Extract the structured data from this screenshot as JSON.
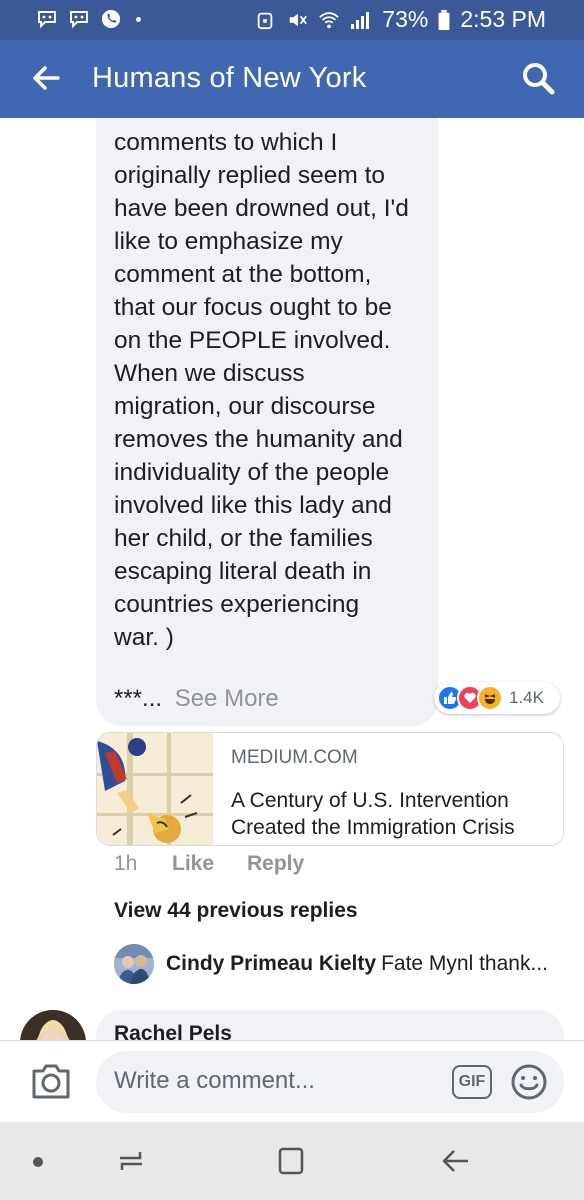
{
  "status_bar": {
    "battery": "73%",
    "time": "2:53 PM"
  },
  "app_bar": {
    "title": "Humans of New York"
  },
  "comment": {
    "text": "comments to which I\noriginally  replied seem to\nhave been drowned out, I'd\nlike to emphasize my\ncomment at the bottom,\nthat our focus ought to be\non the PEOPLE involved.\nWhen we discuss\nmigration, our discourse\nremoves the humanity and\nindividuality of the people\ninvolved like this lady and\nher child, or the families\nescaping literal death in\ncountries experiencing\nwar. )",
    "ellipsis": "***...",
    "see_more": "See More",
    "reaction_count": "1.4K",
    "time": "1h",
    "like_label": "Like",
    "reply_label": "Reply"
  },
  "link_preview": {
    "domain": "MEDIUM.COM",
    "title": "A Century of U.S. Intervention Created the Immigration Crisis"
  },
  "replies": {
    "view_previous": "View 44 previous replies",
    "latest": {
      "name": "Cindy Primeau Kielty",
      "text": "Fate Mynl thank..."
    }
  },
  "next_comment": {
    "name": "Rachel Pels"
  },
  "composer": {
    "placeholder": "Write a comment...",
    "gif_label": "GIF"
  },
  "icons": {
    "status": [
      "messenger-icon",
      "messenger-icon",
      "phone-icon",
      "dot-icon",
      "alarm-icon",
      "mute-icon",
      "wifi-icon",
      "signal-icon",
      "battery-icon"
    ],
    "app_bar": [
      "back-arrow-icon",
      "search-icon"
    ],
    "composer": [
      "camera-icon",
      "gif-icon",
      "emoji-icon"
    ],
    "nav": [
      "nav-dot-icon",
      "recent-apps-icon",
      "home-icon",
      "back-icon"
    ]
  },
  "colors": {
    "facebook_blue": "#4267b2",
    "status_bar": "#3b5998",
    "bubble": "#f0f2f5",
    "muted_text": "#90949c"
  }
}
